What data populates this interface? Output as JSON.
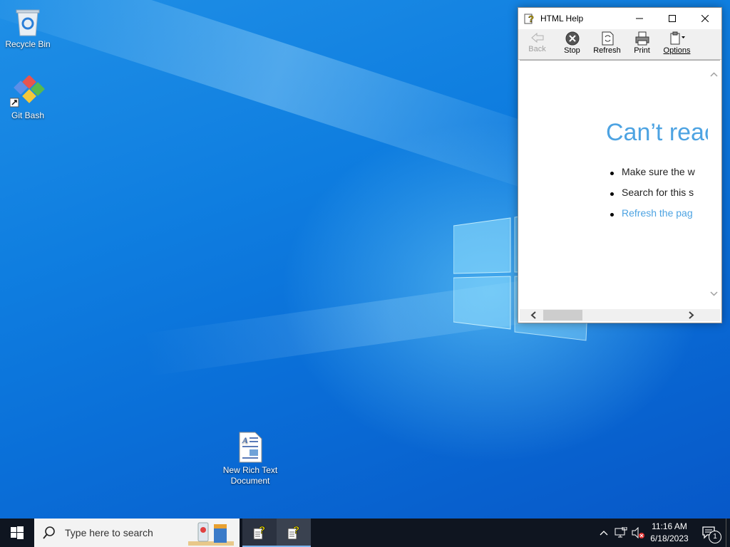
{
  "desktop": {
    "icons": [
      {
        "label": "Recycle Bin",
        "icon": "recycle-bin-icon"
      },
      {
        "label": "Git Bash",
        "icon": "git-bash-icon"
      },
      {
        "label": "New Rich Text Document",
        "icon": "rich-text-document-icon"
      }
    ]
  },
  "help_window": {
    "title": "HTML Help",
    "toolbar": {
      "back": "Back",
      "stop": "Stop",
      "refresh": "Refresh",
      "print": "Print",
      "options": "Options"
    },
    "content": {
      "heading": "Can’t reac",
      "bullets": [
        "Make sure the w",
        "Search for this s",
        "Refresh the pag"
      ]
    }
  },
  "taskbar": {
    "search_placeholder": "Type here to search",
    "time": "11:16 AM",
    "date": "6/18/2023",
    "notification_count": "1"
  },
  "colors": {
    "desktop_blue": "#0f7ee0",
    "link_blue": "#4da3e2",
    "taskbar": "#0f1520",
    "active_underline": "#7eb6ef"
  }
}
